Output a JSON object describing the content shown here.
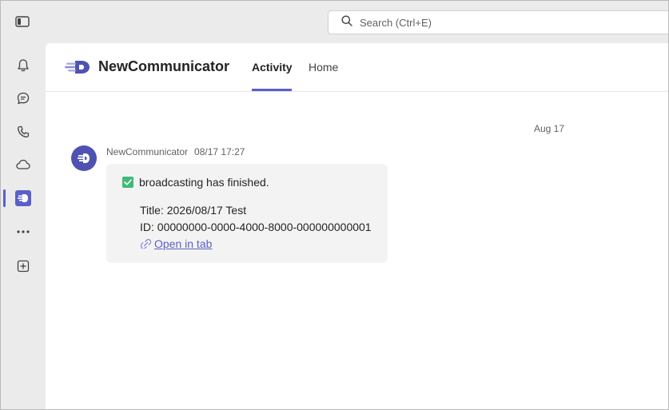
{
  "search": {
    "placeholder": "Search (Ctrl+E)"
  },
  "rail": {
    "items": [
      {
        "icon": "bell-icon"
      },
      {
        "icon": "chat-icon"
      },
      {
        "icon": "phone-icon"
      },
      {
        "icon": "cloud-icon"
      },
      {
        "icon": "newcommunicator-app-icon",
        "active": true
      },
      {
        "icon": "more-icon"
      },
      {
        "icon": "add-app-icon"
      }
    ]
  },
  "app": {
    "name": "NewCommunicator",
    "tabs": [
      {
        "label": "Activity",
        "active": true
      },
      {
        "label": "Home",
        "active": false
      }
    ]
  },
  "feed": {
    "date_divider": "Aug 17",
    "message": {
      "sender": "NewCommunicator",
      "time": "08/17 17:27",
      "status_text": "broadcasting has finished.",
      "title_line": "Title: 2026/08/17 Test",
      "id_line": "ID: 00000000-0000-4000-8000-000000000001",
      "link_label": "Open in tab"
    }
  },
  "colors": {
    "accent": "#5b5fc7",
    "check": "#3fba7a",
    "avatar": "#4f52b2"
  }
}
